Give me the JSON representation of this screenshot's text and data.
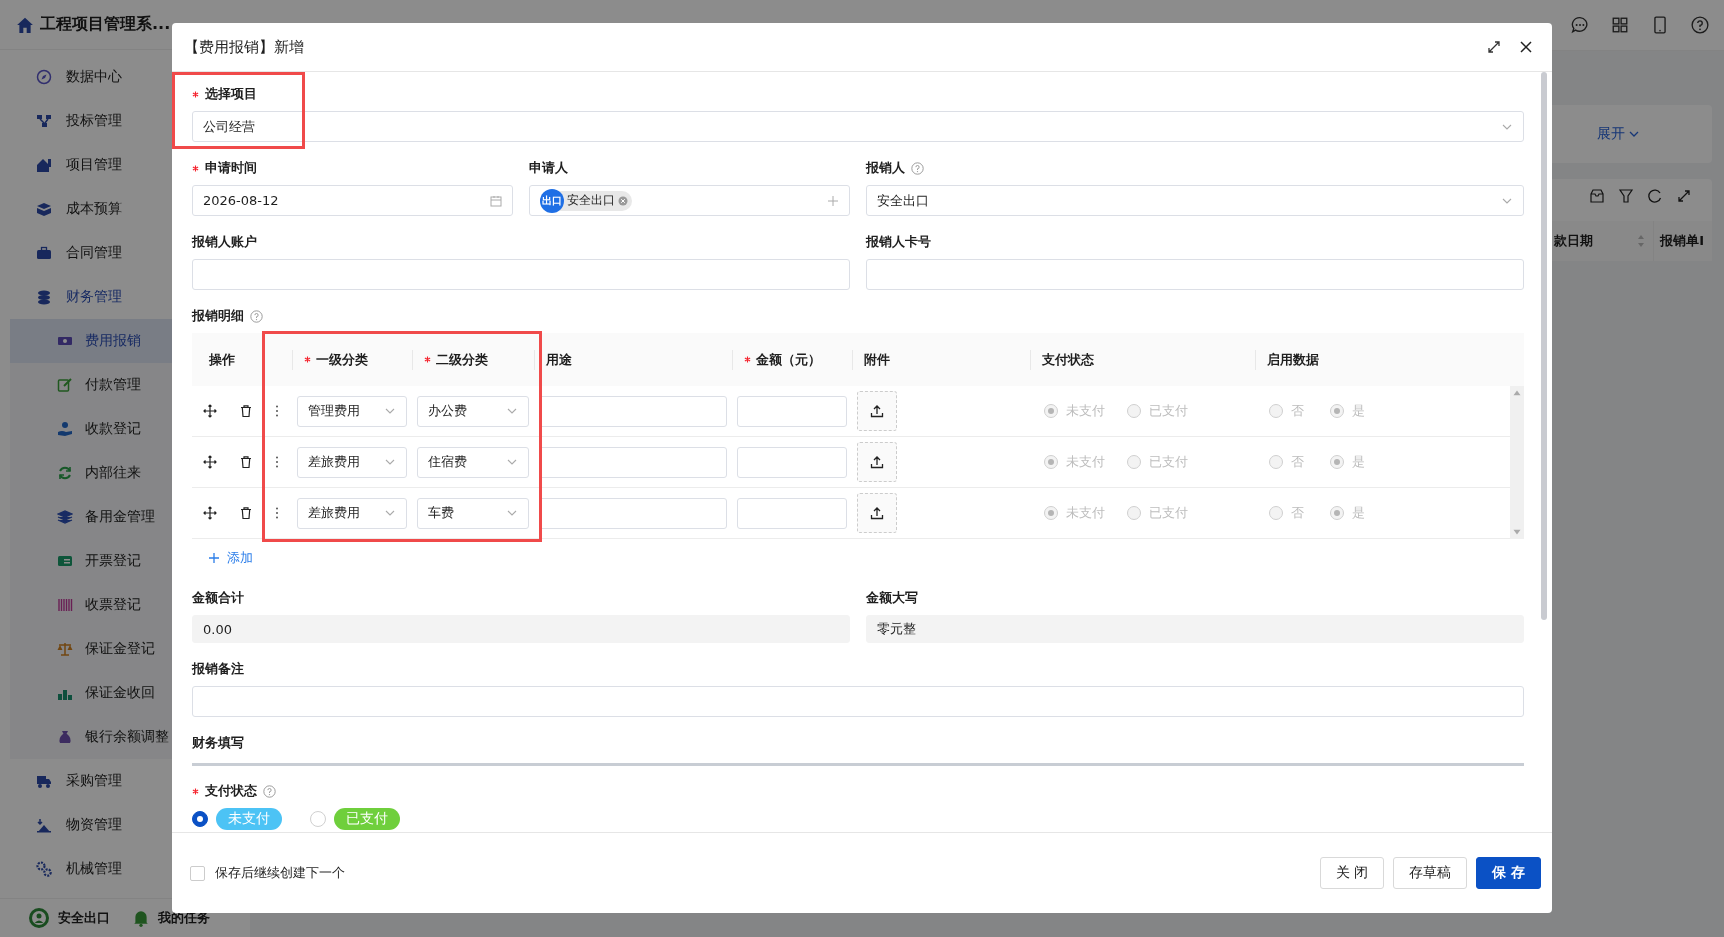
{
  "sidebar": {
    "title": "工程项目管理系...",
    "items": [
      {
        "label": "数据中心",
        "expanded": false
      },
      {
        "label": "投标管理",
        "expanded": false
      },
      {
        "label": "项目管理",
        "expanded": false
      },
      {
        "label": "成本预算",
        "expanded": false
      },
      {
        "label": "合同管理",
        "expanded": false
      },
      {
        "label": "财务管理",
        "expanded": true,
        "children": [
          {
            "label": "费用报销",
            "selected": true
          },
          {
            "label": "付款管理",
            "selected": false
          },
          {
            "label": "收款登记",
            "selected": false
          },
          {
            "label": "内部往来",
            "selected": false
          },
          {
            "label": "备用金管理",
            "selected": false
          },
          {
            "label": "开票登记",
            "selected": false
          },
          {
            "label": "收票登记",
            "selected": false
          },
          {
            "label": "保证金登记",
            "selected": false
          },
          {
            "label": "保证金收回",
            "selected": false
          },
          {
            "label": "银行余额调整",
            "selected": false
          }
        ]
      },
      {
        "label": "采购管理",
        "expanded": false
      },
      {
        "label": "物资管理",
        "expanded": false
      },
      {
        "label": "机械管理",
        "expanded": false
      }
    ],
    "user": "安全出口",
    "tasks": "我的任务"
  },
  "background_page": {
    "expand_link": "展开",
    "table_columns": [
      "款日期",
      "报销单I"
    ]
  },
  "dialog": {
    "title": "【费用报销】新增",
    "project": {
      "label": "选择项目",
      "required": true,
      "value": "公司经营"
    },
    "apply_date": {
      "label": "申请时间",
      "required": true,
      "value": "2026-08-12"
    },
    "applicant": {
      "label": "申请人",
      "required": false,
      "avatar_text": "出口",
      "tag": "安全出口"
    },
    "reimburser": {
      "label": "报销人",
      "required": false,
      "value": "安全出口"
    },
    "account": {
      "label": "报销人账户",
      "required": false
    },
    "card_no": {
      "label": "报销人卡号",
      "required": false
    },
    "details": {
      "label": "报销明细",
      "columns": [
        {
          "label": "操作",
          "required": false
        },
        {
          "label": "一级分类",
          "required": true
        },
        {
          "label": "二级分类",
          "required": true
        },
        {
          "label": "用途",
          "required": false
        },
        {
          "label": "金额（元）",
          "required": true
        },
        {
          "label": "附件",
          "required": false
        },
        {
          "label": "支付状态",
          "required": false
        },
        {
          "label": "启用数据",
          "required": false
        }
      ],
      "rows": [
        {
          "category": "管理费用",
          "subcategory": "办公费",
          "disabled": true,
          "payment": [
            {
              "label": "未支付",
              "selected": true
            },
            {
              "label": "已支付",
              "selected": false
            }
          ],
          "enabled": [
            {
              "label": "否",
              "selected": false
            },
            {
              "label": "是",
              "selected": true
            }
          ]
        },
        {
          "category": "差旅费用",
          "subcategory": "住宿费",
          "disabled": true,
          "payment": [
            {
              "label": "未支付",
              "selected": true
            },
            {
              "label": "已支付",
              "selected": false
            }
          ],
          "enabled": [
            {
              "label": "否",
              "selected": false
            },
            {
              "label": "是",
              "selected": true
            }
          ]
        },
        {
          "category": "差旅费用",
          "subcategory": "车费",
          "disabled": true,
          "payment": [
            {
              "label": "未支付",
              "selected": true
            },
            {
              "label": "已支付",
              "selected": false
            }
          ],
          "enabled": [
            {
              "label": "否",
              "selected": false
            },
            {
              "label": "是",
              "selected": true
            }
          ]
        }
      ],
      "add": "添加"
    },
    "total": {
      "label": "金额合计",
      "required": false,
      "value": "0.00"
    },
    "total_words": {
      "label": "金额大写",
      "required": false,
      "value": "零元整"
    },
    "remark": {
      "label": "报销备注",
      "required": false
    },
    "section": "财务填写",
    "payment_status": {
      "label": "支付状态",
      "required": true,
      "options": [
        {
          "label": "未支付",
          "selected": true,
          "color": "#4cc3f5"
        },
        {
          "label": "已支付",
          "selected": false,
          "color": "#6fcf3c"
        }
      ]
    },
    "continue": {
      "label": "保存后继续创建下一个",
      "checked": false
    },
    "buttons": [
      {
        "label": "关 闭",
        "kind": "default"
      },
      {
        "label": "存草稿",
        "kind": "default"
      },
      {
        "label": "保 存",
        "kind": "primary"
      }
    ]
  }
}
